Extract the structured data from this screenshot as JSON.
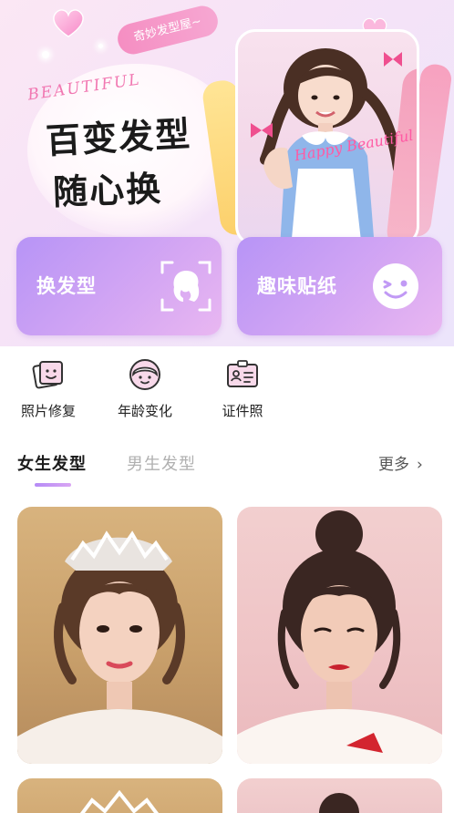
{
  "banner": {
    "tagline": "奇妙发型屋~",
    "script_word": "BEAUTIFUL",
    "headline_line1": "百变发型",
    "headline_line2": "随心换",
    "photo_script": "Happy Beautiful"
  },
  "features": [
    {
      "label": "换发型",
      "icon": "hairstyle-face-scan-icon"
    },
    {
      "label": "趣味贴纸",
      "icon": "wink-smiley-icon"
    }
  ],
  "tools": [
    {
      "label": "照片修复",
      "icon": "photo-restore-icon"
    },
    {
      "label": "年龄变化",
      "icon": "age-change-icon"
    },
    {
      "label": "证件照",
      "icon": "id-photo-icon"
    }
  ],
  "tabs": {
    "active": "女生发型",
    "inactive": "男生发型",
    "more": "更多",
    "more_icon": "chevron-right-icon"
  },
  "colors": {
    "accent_purple": "#b794f6",
    "accent_pink": "#f58ec2",
    "tab_inactive": "#b0b0b0"
  }
}
